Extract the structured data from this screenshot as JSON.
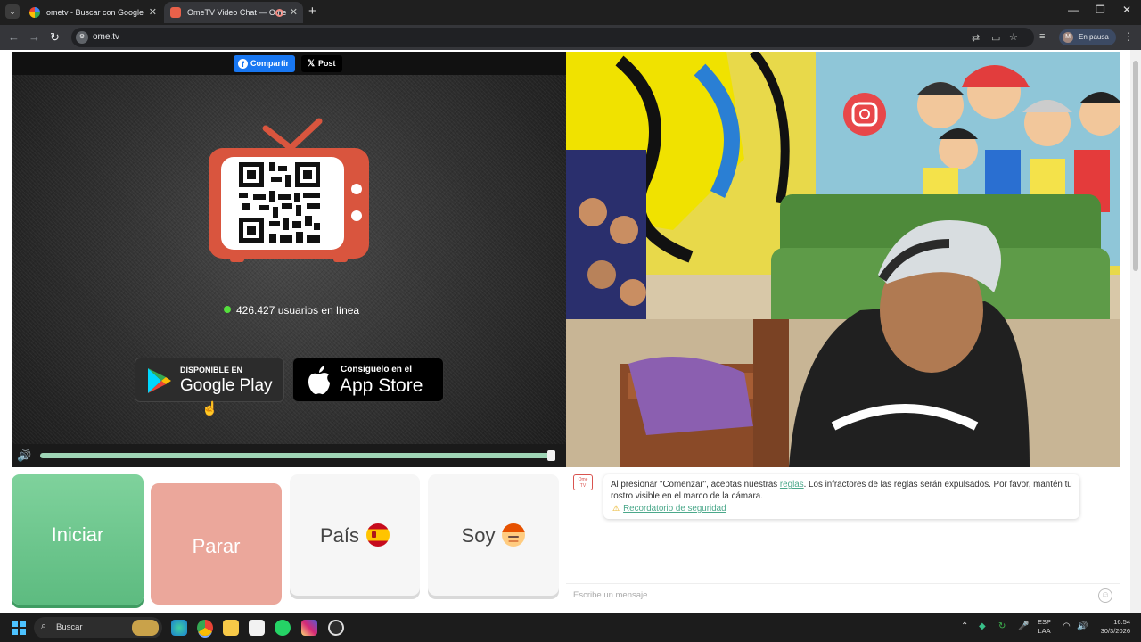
{
  "browser": {
    "tabs": [
      {
        "title": "ometv - Buscar con Google",
        "close": "✕"
      },
      {
        "title": "OmeTV Video Chat — Ome",
        "close": "✕"
      }
    ],
    "new_tab": "+",
    "window_controls": {
      "minimize": "—",
      "maximize": "❐",
      "close": "✕"
    },
    "url": "ome.tv",
    "profile_initial": "M",
    "profile_label": "En pausa"
  },
  "share": {
    "facebook_label": "Compartir",
    "x_label": "Post"
  },
  "online": {
    "text": "426.427 usuarios en línea"
  },
  "stores": {
    "google_small": "DISPONIBLE EN",
    "google_big": "Google Play",
    "apple_small": "Consíguelo en el",
    "apple_big": "App Store"
  },
  "volume": {
    "level_percent": 100
  },
  "buttons": {
    "start": "Iniciar",
    "stop": "Parar",
    "country": "País",
    "gender": "Soy"
  },
  "chat": {
    "rules_part1": "Al presionar \"Comenzar\", aceptas nuestras ",
    "rules_link": "reglas",
    "rules_part2": ". Los infractores de las reglas serán expulsados. Por favor, mantén tu rostro visible en el marco de la cámara.",
    "safety_link": "Recordatorio de seguridad",
    "placeholder": "Escribe un mensaje"
  },
  "taskbar": {
    "search_placeholder": "Buscar",
    "language_top": "ESP",
    "language_bottom": "LAA",
    "time": "16:54",
    "date": "30/3/2026"
  },
  "colors": {
    "start_green": "#5dbb80",
    "stop_salmon": "#eba79b",
    "tv_red": "#d9553e",
    "online_dot": "#55e03d",
    "facebook_blue": "#1877f2"
  }
}
